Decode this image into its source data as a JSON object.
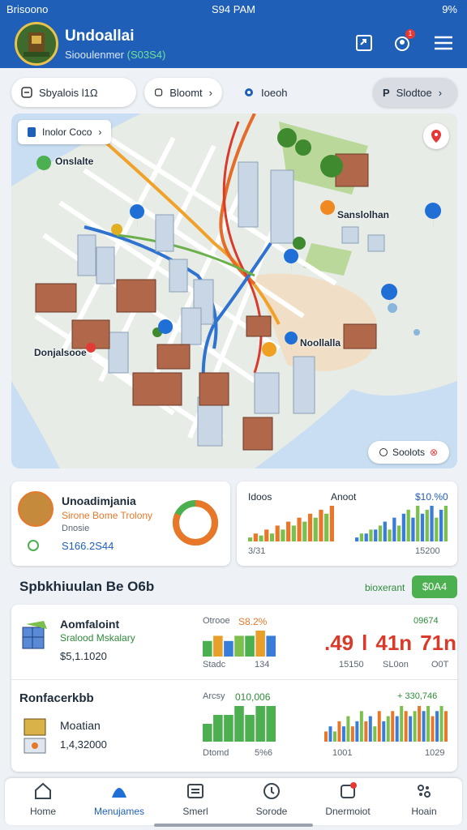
{
  "status_bar": {
    "carrier": "Brisoono",
    "time": "S94 PAM",
    "battery": "9%"
  },
  "header": {
    "title": "Undoallai",
    "subtitle_prefix": "Siooulenmer",
    "subtitle_value": "(S03S4)",
    "notification_badge": "1"
  },
  "chips": [
    {
      "label": "Sbyalois l1Ω",
      "icon": "list-icon"
    },
    {
      "label": "Bloomt",
      "icon": "stop-icon"
    },
    {
      "label": "Ioeoh",
      "icon": "location-icon"
    },
    {
      "label": "Slodtoe",
      "icon": "search-icon"
    }
  ],
  "map": {
    "overlay_label": "Inolor Coco",
    "places": [
      "Onslalte",
      "Sanslolhan",
      "Donjalsooe",
      "Noollalla"
    ],
    "stats_button": "Soolots"
  },
  "summary_card": {
    "name": "Unoadimjania",
    "subtitle": "Sirone Bome Trolony",
    "note": "Dnosie",
    "value": "S166.2S44",
    "donut_fraction": 0.82,
    "donut_colors": [
      "#e8772a",
      "#4caf50"
    ]
  },
  "chart_card": {
    "left_label": "Idoos",
    "mid_label": "Anoot",
    "right_value": "$10.%0",
    "footer_left": "3/31",
    "footer_right": "15200",
    "chart_data": [
      {
        "type": "bar",
        "series": [
          {
            "values": [
              1,
              2,
              1.5,
              3,
              2,
              4,
              3,
              5,
              4,
              6,
              5,
              7,
              6,
              8,
              7,
              9
            ]
          }
        ],
        "colors": [
          "#7bbf4c",
          "#e8772a"
        ]
      },
      {
        "type": "bar",
        "series": [
          {
            "values": [
              1,
              2,
              2,
              3,
              3,
              4,
              5,
              3,
              6,
              4,
              7,
              8,
              6,
              9,
              7,
              8,
              9,
              6,
              8,
              9
            ]
          }
        ],
        "colors": [
          "#3a7dd8",
          "#7bbf4c"
        ]
      }
    ]
  },
  "section": {
    "title": "Spbkhiuulan Be O6b",
    "link": "bioxerant",
    "action": "$0A4"
  },
  "list_items": [
    {
      "title": "Aomfaloint",
      "subtitle": "Sralood Mskalary",
      "price": "$5,1.1020",
      "bar_header_label": "Otrooe",
      "bar_header_value": "S8.2%",
      "bar_footer_label": "Stadc",
      "bar_footer_value": "134",
      "big_numbers": [
        ".49",
        "l",
        "41n",
        "71n"
      ],
      "right_header": "09674",
      "right_footer": [
        "15150",
        "SL0on",
        "O0T"
      ],
      "chart_data": {
        "type": "bar",
        "series": [
          {
            "values": [
              3,
              4,
              3,
              4,
              4,
              5,
              4
            ]
          }
        ],
        "colors": [
          "#4caf50",
          "#e8a02a",
          "#3a7dd8",
          "#7bbf4c"
        ]
      }
    },
    {
      "title": "Ronfacerkbb",
      "subtitle": "Moatian",
      "price": "1,4,32000",
      "bar_header_label": "Arcsy",
      "bar_header_value": "010,006",
      "bar_footer_label": "Dtomd",
      "bar_footer_value": "5%6",
      "right_header": "+ 330,746",
      "right_footer": [
        "1001",
        "1029"
      ],
      "chart_data": [
        {
          "type": "bar",
          "series": [
            {
              "values": [
                2,
                3,
                3,
                4,
                3,
                4,
                4
              ]
            }
          ],
          "colors": [
            "#4caf50"
          ]
        },
        {
          "type": "bar",
          "series": [
            {
              "values": [
                2,
                3,
                2,
                4,
                3,
                5,
                3,
                4,
                6,
                4,
                5,
                3,
                6,
                4,
                5,
                6,
                5,
                7,
                6,
                5,
                6,
                7,
                6,
                7,
                5,
                6,
                7,
                6
              ]
            }
          ],
          "colors": [
            "#e8772a",
            "#3a7dd8",
            "#7bbf4c"
          ]
        }
      ]
    }
  ],
  "nav": [
    {
      "label": "Home",
      "icon": "home-icon"
    },
    {
      "label": "Menujames",
      "icon": "map-icon",
      "active": true
    },
    {
      "label": "Smerl",
      "icon": "list-icon"
    },
    {
      "label": "Sorode",
      "icon": "compass-icon"
    },
    {
      "label": "Dnermoiot",
      "icon": "bell-icon"
    },
    {
      "label": "Hoain",
      "icon": "settings-icon"
    }
  ]
}
